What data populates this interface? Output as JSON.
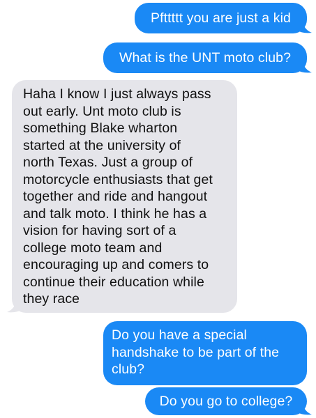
{
  "conversation": {
    "messages": [
      {
        "direction": "outgoing",
        "text": "Pfttttt you are just a kid"
      },
      {
        "direction": "outgoing",
        "text": "What is the UNT moto club?"
      },
      {
        "direction": "incoming",
        "text": "Haha I know I just always pass\nout early. Unt moto club is\nsomething Blake wharton\nstarted at the university of\nnorth Texas. Just a group of\nmotorcycle enthusiasts that get\ntogether and ride and hangout\nand talk moto. I think he has a\nvision for having sort of a\ncollege moto team and\nencouraging up and comers to\ncontinue their education while\nthey race"
      },
      {
        "direction": "outgoing",
        "text": "Do you have a special\nhandshake to be part of the\nclub?"
      },
      {
        "direction": "outgoing",
        "text": "Do you go to college?"
      }
    ]
  },
  "colors": {
    "outgoing_bubble": "#1a89f5",
    "incoming_bubble": "#e5e5ea",
    "background": "#ffffff"
  }
}
